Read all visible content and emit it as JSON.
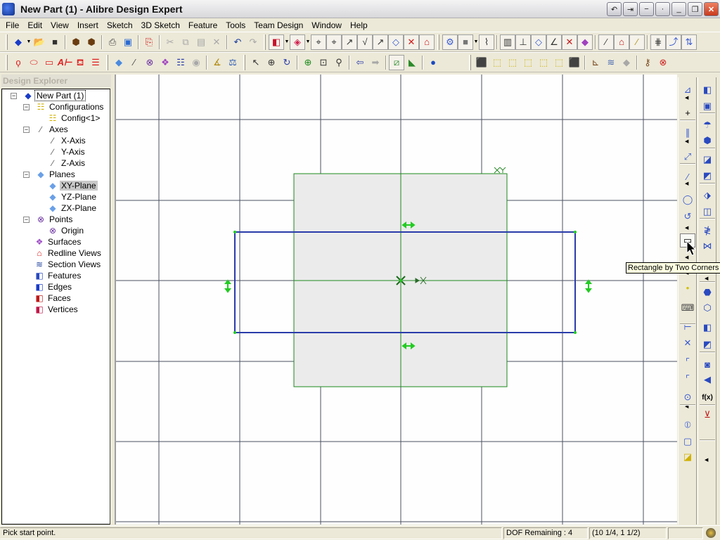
{
  "window": {
    "title": "New Part (1) - Alibre Design Expert",
    "controls": [
      "restore-back",
      "pin",
      "minimize-alt",
      "dot",
      "minimize",
      "restore",
      "close"
    ]
  },
  "menu": [
    "File",
    "Edit",
    "View",
    "Insert",
    "Sketch",
    "3D Sketch",
    "Feature",
    "Tools",
    "Team Design",
    "Window",
    "Help"
  ],
  "toolbar1": {
    "groups": [
      [
        "new-part",
        "open-folder",
        "save-disk"
      ],
      [
        "check-out",
        "check-in"
      ],
      [
        "print",
        "print-preview"
      ],
      [
        "export-pdf"
      ],
      [
        "cut",
        "copy",
        "paste",
        "delete"
      ],
      [
        "undo",
        "redo"
      ],
      [
        "display-mode",
        "color-mode"
      ],
      [
        "sketch-tool-1",
        "sketch-tool-2",
        "sketch-tool-3",
        "sketch-tool-4",
        "sketch-tool-5",
        "sketch-tool-6",
        "sketch-tool-7"
      ],
      [
        "constraint-tool",
        "shaded-box",
        "constraint-2"
      ],
      [
        "dim-1",
        "dim-2",
        "dim-3",
        "dim-4",
        "dim-5",
        "dim-6"
      ],
      [
        "ref-1",
        "ref-2",
        "ref-3"
      ],
      [
        "grid-1",
        "grid-2",
        "grid-3"
      ]
    ]
  },
  "toolbar2": {
    "groups": [
      [
        "sketch-spline",
        "sketch-ellipse",
        "sketch-rectangle",
        "sketch-text",
        "fill-color",
        "line-style"
      ],
      [
        "show-planes",
        "show-axes",
        "show-points",
        "show-surfaces",
        "show-configs",
        "show-hidden"
      ],
      [
        "measure",
        "properties-balance"
      ],
      [
        "select-arrow",
        "pan",
        "rotate"
      ],
      [
        "zoom-in",
        "zoom-window",
        "zoom-fit"
      ],
      [
        "view-back",
        "view-forward"
      ],
      [
        "normal-to-sketch",
        "sketch-plane"
      ],
      [
        "render"
      ],
      [
        "view-iso",
        "view-front",
        "view-back-cube",
        "view-left",
        "view-right",
        "view-top",
        "view-bottom"
      ],
      [
        "section-1",
        "section-2",
        "section-3"
      ],
      [
        "inspect",
        "origin-triad"
      ]
    ]
  },
  "explorer": {
    "title": "Design Explorer",
    "items": [
      {
        "label": "New Part (1)",
        "icon": "part-icon",
        "level": 0,
        "toggle": "−",
        "focused": true
      },
      {
        "label": "Configurations",
        "icon": "configurations-icon",
        "level": 1,
        "toggle": "−"
      },
      {
        "label": "Config<1>",
        "icon": "config-icon",
        "level": 2
      },
      {
        "label": "Axes",
        "icon": "axes-icon",
        "level": 1,
        "toggle": "−"
      },
      {
        "label": "X-Axis",
        "icon": "axis-icon",
        "level": 2
      },
      {
        "label": "Y-Axis",
        "icon": "axis-icon",
        "level": 2
      },
      {
        "label": "Z-Axis",
        "icon": "axis-icon",
        "level": 2
      },
      {
        "label": "Planes",
        "icon": "planes-icon",
        "level": 1,
        "toggle": "−"
      },
      {
        "label": "XY-Plane",
        "icon": "plane-icon",
        "level": 2,
        "selected": true
      },
      {
        "label": "YZ-Plane",
        "icon": "plane-icon",
        "level": 2
      },
      {
        "label": "ZX-Plane",
        "icon": "plane-icon",
        "level": 2
      },
      {
        "label": "Points",
        "icon": "points-icon",
        "level": 1,
        "toggle": "−"
      },
      {
        "label": "Origin",
        "icon": "origin-icon",
        "level": 2
      },
      {
        "label": "Surfaces",
        "icon": "surfaces-icon",
        "level": 1
      },
      {
        "label": "Redline Views",
        "icon": "redline-views-icon",
        "level": 1
      },
      {
        "label": "Section Views",
        "icon": "section-views-icon",
        "level": 1
      },
      {
        "label": "Features",
        "icon": "features-icon",
        "level": 1
      },
      {
        "label": "Edges",
        "icon": "edges-icon",
        "level": 1
      },
      {
        "label": "Faces",
        "icon": "faces-icon",
        "level": 1
      },
      {
        "label": "Vertices",
        "icon": "vertices-icon",
        "level": 1
      }
    ]
  },
  "sketch_tools": [
    "activate-sketch",
    "point",
    "parallel-line",
    "dimension",
    "line",
    "circle",
    "arc",
    "rectangle-by-two-corners",
    "sketch-point",
    "keyboard-input",
    "perpendicular",
    "intersection",
    "fillet",
    "chamfer",
    "offset",
    "mirror",
    "trim",
    "project-to-sketch"
  ],
  "feature_tools": [
    "extrude-boss",
    "shell",
    "revolve",
    "sweep",
    "chamfer-feature",
    "fillet-feature",
    "loft",
    "draft",
    "helix",
    "thread",
    "pattern",
    "sweep-cut",
    "cut",
    "cut-2",
    "hole",
    "replace",
    "equations",
    "measure-dim"
  ],
  "tooltip": "Rectangle by Two Corners",
  "canvas": {
    "colors": {
      "background": "#fefefe",
      "grid": "#4a5060",
      "sketch_plane_fill": "#ebebeb",
      "sketch_plane_edge": "#1c8a1c",
      "rectangle": "#2a3caa",
      "handles": "#22cc22"
    }
  },
  "status": {
    "prompt": "Pick start point.",
    "dof": "DOF Remaining : 4",
    "coordinates": "(10 1/4, 1 1/2)"
  }
}
